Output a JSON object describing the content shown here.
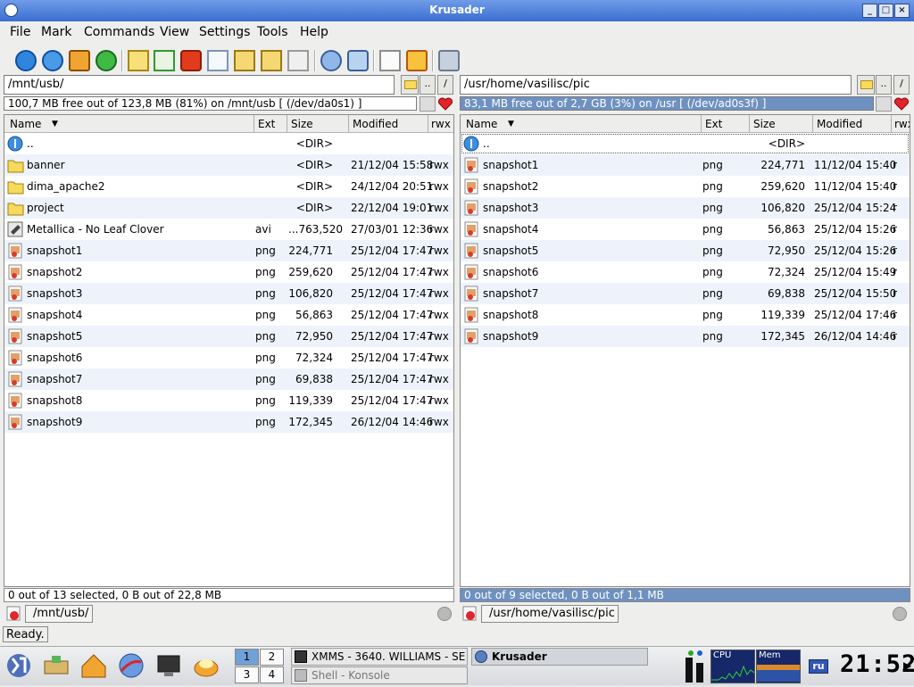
{
  "window": {
    "title": "Krusader"
  },
  "menu": [
    "File",
    "Mark",
    "Commands",
    "View",
    "Settings",
    "Tools",
    "Help"
  ],
  "toolbar_icons": [
    "back-icon",
    "info-icon",
    "home-icon",
    "refresh-icon",
    "copy-doc-icon",
    "check-icon",
    "delete-icon",
    "new-file-icon",
    "move-left-icon",
    "move-right-icon",
    "duplicate-icon",
    "sync-icon",
    "remote-drive-icon",
    "blank-page-icon",
    "edit-icon",
    "tools-icon"
  ],
  "left": {
    "path": "/mnt/usb/",
    "dotdot": "..",
    "root": "/",
    "free": "100,7 MB free out of 123,8 MB (81%) on /mnt/usb [ (/dev/da0s1) ]",
    "columns": {
      "name": "Name",
      "ext": "Ext",
      "size": "Size",
      "modified": "Modified",
      "perms": "rwx"
    },
    "files": [
      {
        "name": "..",
        "ext": "",
        "size": "<DIR>",
        "modified": "",
        "perms": "",
        "icon": "up-icon"
      },
      {
        "name": "banner",
        "ext": "",
        "size": "<DIR>",
        "modified": "21/12/04 15:58",
        "perms": "rwx",
        "icon": "folder-icon"
      },
      {
        "name": "dima_apache2",
        "ext": "",
        "size": "<DIR>",
        "modified": "24/12/04 20:51",
        "perms": "rwx",
        "icon": "folder-icon"
      },
      {
        "name": "project",
        "ext": "",
        "size": "<DIR>",
        "modified": "22/12/04 19:01",
        "perms": "rwx",
        "icon": "folder-icon"
      },
      {
        "name": "Metallica - No Leaf Clover",
        "ext": "avi",
        "size": "...763,520",
        "modified": "27/03/01 12:36",
        "perms": "rwx",
        "icon": "video-icon"
      },
      {
        "name": "snapshot1",
        "ext": "png",
        "size": "224,771",
        "modified": "25/12/04 17:47",
        "perms": "rwx",
        "icon": "image-icon"
      },
      {
        "name": "snapshot2",
        "ext": "png",
        "size": "259,620",
        "modified": "25/12/04 17:47",
        "perms": "rwx",
        "icon": "image-icon"
      },
      {
        "name": "snapshot3",
        "ext": "png",
        "size": "106,820",
        "modified": "25/12/04 17:47",
        "perms": "rwx",
        "icon": "image-icon"
      },
      {
        "name": "snapshot4",
        "ext": "png",
        "size": "56,863",
        "modified": "25/12/04 17:47",
        "perms": "rwx",
        "icon": "image-icon"
      },
      {
        "name": "snapshot5",
        "ext": "png",
        "size": "72,950",
        "modified": "25/12/04 17:47",
        "perms": "rwx",
        "icon": "image-icon"
      },
      {
        "name": "snapshot6",
        "ext": "png",
        "size": "72,324",
        "modified": "25/12/04 17:47",
        "perms": "rwx",
        "icon": "image-icon"
      },
      {
        "name": "snapshot7",
        "ext": "png",
        "size": "69,838",
        "modified": "25/12/04 17:47",
        "perms": "rwx",
        "icon": "image-icon"
      },
      {
        "name": "snapshot8",
        "ext": "png",
        "size": "119,339",
        "modified": "25/12/04 17:47",
        "perms": "rwx",
        "icon": "image-icon"
      },
      {
        "name": "snapshot9",
        "ext": "png",
        "size": "172,345",
        "modified": "26/12/04 14:46",
        "perms": "rwx",
        "icon": "image-icon"
      }
    ],
    "status": "0 out of 13 selected, 0 B out of 22,8 MB",
    "tab": "/mnt/usb/"
  },
  "right": {
    "path": "/usr/home/vasilisc/pic",
    "dotdot": "..",
    "root": "/",
    "free": "83,1 MB free out of 2,7 GB (3%) on /usr [ (/dev/ad0s3f) ]",
    "columns": {
      "name": "Name",
      "ext": "Ext",
      "size": "Size",
      "modified": "Modified",
      "perms": "rwx"
    },
    "files": [
      {
        "name": "..",
        "ext": "",
        "size": "<DIR>",
        "modified": "",
        "perms": "",
        "icon": "up-icon"
      },
      {
        "name": "snapshot1",
        "ext": "png",
        "size": "224,771",
        "modified": "11/12/04 15:40",
        "perms": "r",
        "icon": "image-icon"
      },
      {
        "name": "snapshot2",
        "ext": "png",
        "size": "259,620",
        "modified": "11/12/04 15:40",
        "perms": "r",
        "icon": "image-icon"
      },
      {
        "name": "snapshot3",
        "ext": "png",
        "size": "106,820",
        "modified": "25/12/04 15:24",
        "perms": "r",
        "icon": "image-icon"
      },
      {
        "name": "snapshot4",
        "ext": "png",
        "size": "56,863",
        "modified": "25/12/04 15:26",
        "perms": "r",
        "icon": "image-icon"
      },
      {
        "name": "snapshot5",
        "ext": "png",
        "size": "72,950",
        "modified": "25/12/04 15:26",
        "perms": "r",
        "icon": "image-icon"
      },
      {
        "name": "snapshot6",
        "ext": "png",
        "size": "72,324",
        "modified": "25/12/04 15:49",
        "perms": "r",
        "icon": "image-icon"
      },
      {
        "name": "snapshot7",
        "ext": "png",
        "size": "69,838",
        "modified": "25/12/04 15:50",
        "perms": "r",
        "icon": "image-icon"
      },
      {
        "name": "snapshot8",
        "ext": "png",
        "size": "119,339",
        "modified": "25/12/04 17:46",
        "perms": "r",
        "icon": "image-icon"
      },
      {
        "name": "snapshot9",
        "ext": "png",
        "size": "172,345",
        "modified": "26/12/04 14:46",
        "perms": "r",
        "icon": "image-icon"
      }
    ],
    "status": "0 out of 9 selected, 0 B out of 1,1 MB",
    "tab": "/usr/home/vasilisc/pic"
  },
  "statusbar": {
    "text": "Ready."
  },
  "taskbar": {
    "desktops": [
      "1",
      "2",
      "3",
      "4"
    ],
    "active_desktop": "1",
    "tasks": [
      {
        "label": "XMMS - 3640. WILLIAMS - SE",
        "icon": "xmms-icon"
      },
      {
        "label": "Shell - Konsole",
        "icon": "konsole-icon"
      },
      {
        "label": "Krusader",
        "icon": "krusader-icon"
      }
    ],
    "cpu_label": "CPU",
    "mem_label": "Mem",
    "keyboard": "ru",
    "clock": "21:52"
  },
  "colors": {
    "titlebar": "#3a6fd0",
    "active_bar": "#6e91c1",
    "selection": "#6e91c1"
  }
}
